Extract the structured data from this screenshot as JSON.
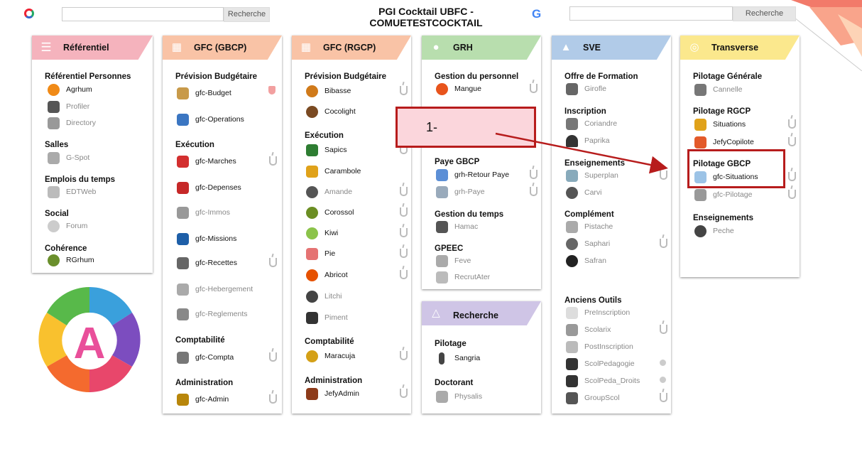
{
  "header": {
    "title": "PGI Cocktail UBFC - COMUETESTCOCKTAIL",
    "search_left": {
      "button": "Recherche",
      "value": ""
    },
    "search_right": {
      "button": "Recherche",
      "value": ""
    }
  },
  "annotation": {
    "label": "1-"
  },
  "colors": {
    "referentiel": "#f5b3bd",
    "gfc_gbcp": "#f9c3a6",
    "gfc_rgcp": "#f9c3a6",
    "grh": "#b8deae",
    "sve": "#b1cbe8",
    "transverse": "#fbe88d",
    "recherche": "#cfc5e6",
    "annotation_red": "#b71c1c"
  },
  "cards": {
    "referentiel": {
      "title": "Référentiel",
      "icon": "database-icon",
      "sections": [
        {
          "title": "Référentiel Personnes",
          "apps": [
            {
              "label": "Agrhum"
            },
            {
              "label": "Profiler"
            },
            {
              "label": "Directory"
            }
          ]
        },
        {
          "title": "Salles",
          "apps": [
            {
              "label": "G-Spot"
            }
          ]
        },
        {
          "title": "Emplois du temps",
          "apps": [
            {
              "label": "EDTWeb"
            }
          ]
        },
        {
          "title": "Social",
          "apps": [
            {
              "label": "Forum"
            }
          ]
        },
        {
          "title": "Cohérence",
          "apps": [
            {
              "label": "RGrhum"
            }
          ]
        }
      ]
    },
    "gfc_gbcp": {
      "title": "GFC (GBCP)",
      "icon": "grid-icon",
      "sections": [
        {
          "title": "Prévision Budgétaire",
          "apps": [
            {
              "label": "gfc-Budget"
            },
            {
              "label": "gfc-Operations"
            }
          ]
        },
        {
          "title": "Exécution",
          "apps": [
            {
              "label": "gfc-Marches"
            },
            {
              "label": "gfc-Depenses"
            },
            {
              "label": "gfc-Immos"
            },
            {
              "label": "gfc-Missions"
            },
            {
              "label": "gfc-Recettes"
            },
            {
              "label": "gfc-Hebergement"
            },
            {
              "label": "gfc-Reglements"
            }
          ]
        },
        {
          "title": "Comptabilité",
          "apps": [
            {
              "label": "gfc-Compta"
            }
          ]
        },
        {
          "title": "Administration",
          "apps": [
            {
              "label": "gfc-Admin"
            }
          ]
        }
      ]
    },
    "gfc_rgcp": {
      "title": "GFC (RGCP)",
      "icon": "grid-icon",
      "sections": [
        {
          "title": "Prévision Budgétaire",
          "apps": [
            {
              "label": "Bibasse"
            },
            {
              "label": "Cocolight"
            }
          ]
        },
        {
          "title": "Exécution",
          "apps": [
            {
              "label": "Sapics"
            },
            {
              "label": "Carambole"
            },
            {
              "label": "Amande"
            },
            {
              "label": "Corossol"
            },
            {
              "label": "Kiwi"
            },
            {
              "label": "Pie"
            },
            {
              "label": "Abricot"
            },
            {
              "label": "Litchi"
            },
            {
              "label": "Piment"
            }
          ]
        },
        {
          "title": "Comptabilité",
          "apps": [
            {
              "label": "Maracuja"
            }
          ]
        },
        {
          "title": "Administration",
          "apps": [
            {
              "label": "JefyAdmin"
            }
          ]
        }
      ]
    },
    "grh": {
      "title": "GRH",
      "icon": "people-icon",
      "sections": [
        {
          "title": "Gestion du personnel",
          "apps": [
            {
              "label": "Mangue"
            }
          ]
        },
        {
          "title": "Paye GBCP",
          "apps": [
            {
              "label": "grh-Retour Paye"
            },
            {
              "label": "grh-Paye"
            }
          ]
        },
        {
          "title": "Gestion du temps",
          "apps": [
            {
              "label": "Hamac"
            }
          ]
        },
        {
          "title": "GPEEC",
          "apps": [
            {
              "label": "Feve"
            },
            {
              "label": "RecrutAter"
            }
          ]
        }
      ]
    },
    "recherche": {
      "title": "Recherche",
      "icon": "flask-icon",
      "sections": [
        {
          "title": "Pilotage",
          "apps": [
            {
              "label": "Sangria"
            }
          ]
        },
        {
          "title": "Doctorant",
          "apps": [
            {
              "label": "Physalis"
            }
          ]
        }
      ]
    },
    "sve": {
      "title": "SVE",
      "icon": "graduation-cap-icon",
      "sections": [
        {
          "title": "Offre de Formation",
          "apps": [
            {
              "label": "Girofle"
            }
          ]
        },
        {
          "title": "Inscription",
          "apps": [
            {
              "label": "Coriandre"
            },
            {
              "label": "Paprika"
            }
          ]
        },
        {
          "title": "Enseignements",
          "apps": [
            {
              "label": "Superplan"
            },
            {
              "label": "Carvi"
            }
          ]
        },
        {
          "title": "Complément",
          "apps": [
            {
              "label": "Pistache"
            },
            {
              "label": "Saphari"
            },
            {
              "label": "Safran"
            }
          ]
        },
        {
          "title": "Anciens Outils",
          "apps": [
            {
              "label": "PreInscription"
            },
            {
              "label": "Scolarix"
            },
            {
              "label": "PostInscription"
            },
            {
              "label": "ScolPedagogie"
            },
            {
              "label": "ScolPeda_Droits"
            },
            {
              "label": "GroupScol"
            }
          ]
        }
      ]
    },
    "transverse": {
      "title": "Transverse",
      "icon": "globe-icon",
      "sections": [
        {
          "title": "Pilotage Générale",
          "apps": [
            {
              "label": "Cannelle"
            }
          ]
        },
        {
          "title": "Pilotage RGCP",
          "apps": [
            {
              "label": "Situations"
            },
            {
              "label": "JefyCopilote"
            }
          ]
        },
        {
          "title": "Pilotage GBCP",
          "apps": [
            {
              "label": "gfc-Situations"
            },
            {
              "label": "gfc-Pilotage"
            }
          ]
        },
        {
          "title": "Enseignements",
          "apps": [
            {
              "label": "Peche"
            }
          ]
        }
      ]
    }
  }
}
